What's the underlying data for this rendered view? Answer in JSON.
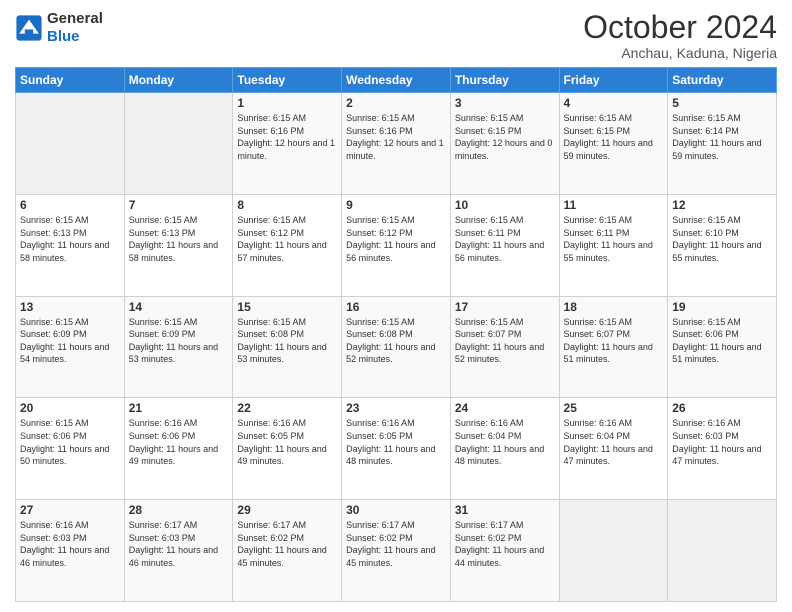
{
  "header": {
    "logo_line1": "General",
    "logo_line2": "Blue",
    "month": "October 2024",
    "location": "Anchau, Kaduna, Nigeria"
  },
  "days_of_week": [
    "Sunday",
    "Monday",
    "Tuesday",
    "Wednesday",
    "Thursday",
    "Friday",
    "Saturday"
  ],
  "weeks": [
    [
      {
        "day": "",
        "info": ""
      },
      {
        "day": "",
        "info": ""
      },
      {
        "day": "1",
        "info": "Sunrise: 6:15 AM\nSunset: 6:16 PM\nDaylight: 12 hours and 1 minute."
      },
      {
        "day": "2",
        "info": "Sunrise: 6:15 AM\nSunset: 6:16 PM\nDaylight: 12 hours and 1 minute."
      },
      {
        "day": "3",
        "info": "Sunrise: 6:15 AM\nSunset: 6:15 PM\nDaylight: 12 hours and 0 minutes."
      },
      {
        "day": "4",
        "info": "Sunrise: 6:15 AM\nSunset: 6:15 PM\nDaylight: 11 hours and 59 minutes."
      },
      {
        "day": "5",
        "info": "Sunrise: 6:15 AM\nSunset: 6:14 PM\nDaylight: 11 hours and 59 minutes."
      }
    ],
    [
      {
        "day": "6",
        "info": "Sunrise: 6:15 AM\nSunset: 6:13 PM\nDaylight: 11 hours and 58 minutes."
      },
      {
        "day": "7",
        "info": "Sunrise: 6:15 AM\nSunset: 6:13 PM\nDaylight: 11 hours and 58 minutes."
      },
      {
        "day": "8",
        "info": "Sunrise: 6:15 AM\nSunset: 6:12 PM\nDaylight: 11 hours and 57 minutes."
      },
      {
        "day": "9",
        "info": "Sunrise: 6:15 AM\nSunset: 6:12 PM\nDaylight: 11 hours and 56 minutes."
      },
      {
        "day": "10",
        "info": "Sunrise: 6:15 AM\nSunset: 6:11 PM\nDaylight: 11 hours and 56 minutes."
      },
      {
        "day": "11",
        "info": "Sunrise: 6:15 AM\nSunset: 6:11 PM\nDaylight: 11 hours and 55 minutes."
      },
      {
        "day": "12",
        "info": "Sunrise: 6:15 AM\nSunset: 6:10 PM\nDaylight: 11 hours and 55 minutes."
      }
    ],
    [
      {
        "day": "13",
        "info": "Sunrise: 6:15 AM\nSunset: 6:09 PM\nDaylight: 11 hours and 54 minutes."
      },
      {
        "day": "14",
        "info": "Sunrise: 6:15 AM\nSunset: 6:09 PM\nDaylight: 11 hours and 53 minutes."
      },
      {
        "day": "15",
        "info": "Sunrise: 6:15 AM\nSunset: 6:08 PM\nDaylight: 11 hours and 53 minutes."
      },
      {
        "day": "16",
        "info": "Sunrise: 6:15 AM\nSunset: 6:08 PM\nDaylight: 11 hours and 52 minutes."
      },
      {
        "day": "17",
        "info": "Sunrise: 6:15 AM\nSunset: 6:07 PM\nDaylight: 11 hours and 52 minutes."
      },
      {
        "day": "18",
        "info": "Sunrise: 6:15 AM\nSunset: 6:07 PM\nDaylight: 11 hours and 51 minutes."
      },
      {
        "day": "19",
        "info": "Sunrise: 6:15 AM\nSunset: 6:06 PM\nDaylight: 11 hours and 51 minutes."
      }
    ],
    [
      {
        "day": "20",
        "info": "Sunrise: 6:15 AM\nSunset: 6:06 PM\nDaylight: 11 hours and 50 minutes."
      },
      {
        "day": "21",
        "info": "Sunrise: 6:16 AM\nSunset: 6:06 PM\nDaylight: 11 hours and 49 minutes."
      },
      {
        "day": "22",
        "info": "Sunrise: 6:16 AM\nSunset: 6:05 PM\nDaylight: 11 hours and 49 minutes."
      },
      {
        "day": "23",
        "info": "Sunrise: 6:16 AM\nSunset: 6:05 PM\nDaylight: 11 hours and 48 minutes."
      },
      {
        "day": "24",
        "info": "Sunrise: 6:16 AM\nSunset: 6:04 PM\nDaylight: 11 hours and 48 minutes."
      },
      {
        "day": "25",
        "info": "Sunrise: 6:16 AM\nSunset: 6:04 PM\nDaylight: 11 hours and 47 minutes."
      },
      {
        "day": "26",
        "info": "Sunrise: 6:16 AM\nSunset: 6:03 PM\nDaylight: 11 hours and 47 minutes."
      }
    ],
    [
      {
        "day": "27",
        "info": "Sunrise: 6:16 AM\nSunset: 6:03 PM\nDaylight: 11 hours and 46 minutes."
      },
      {
        "day": "28",
        "info": "Sunrise: 6:17 AM\nSunset: 6:03 PM\nDaylight: 11 hours and 46 minutes."
      },
      {
        "day": "29",
        "info": "Sunrise: 6:17 AM\nSunset: 6:02 PM\nDaylight: 11 hours and 45 minutes."
      },
      {
        "day": "30",
        "info": "Sunrise: 6:17 AM\nSunset: 6:02 PM\nDaylight: 11 hours and 45 minutes."
      },
      {
        "day": "31",
        "info": "Sunrise: 6:17 AM\nSunset: 6:02 PM\nDaylight: 11 hours and 44 minutes."
      },
      {
        "day": "",
        "info": ""
      },
      {
        "day": "",
        "info": ""
      }
    ]
  ]
}
